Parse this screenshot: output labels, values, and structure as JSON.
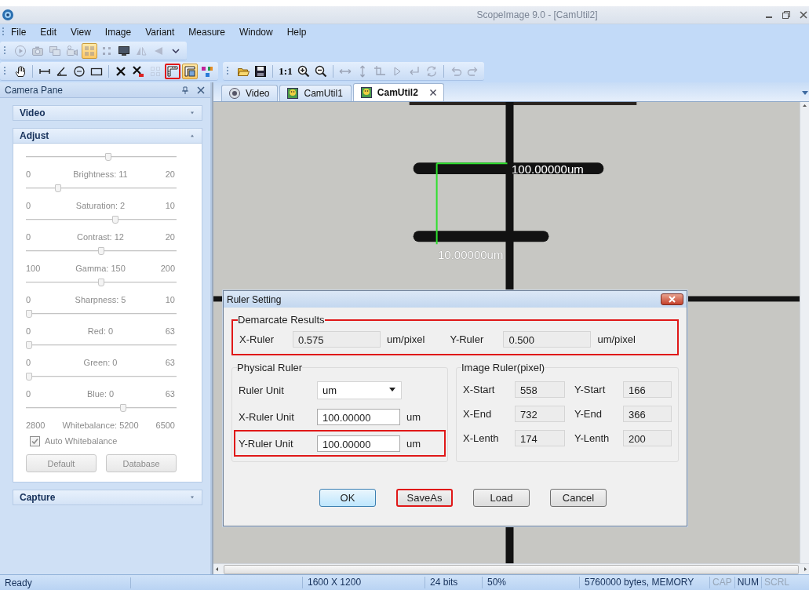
{
  "window": {
    "title": "ScopeImage 9.0 - [CamUtil2]"
  },
  "menu": [
    {
      "label": "File"
    },
    {
      "label": "Edit"
    },
    {
      "label": "View"
    },
    {
      "label": "Image"
    },
    {
      "label": "Variant"
    },
    {
      "label": "Measure"
    },
    {
      "label": "Window"
    },
    {
      "label": "Help"
    }
  ],
  "toolbar_rows": [
    [
      {
        "items": [
          {
            "kind": "play",
            "disabled": true,
            "selected": false,
            "highlighted": false
          },
          {
            "kind": "camera",
            "disabled": true,
            "selected": false,
            "highlighted": false
          },
          {
            "kind": "photos",
            "disabled": true,
            "selected": false,
            "highlighted": false
          },
          {
            "kind": "video",
            "disabled": true,
            "selected": false,
            "highlighted": false
          },
          {
            "kind": "grid",
            "disabled": true,
            "selected": true,
            "highlighted": false
          },
          {
            "kind": "dots",
            "disabled": true,
            "selected": false,
            "highlighted": false
          },
          {
            "kind": "monitor",
            "disabled": false,
            "selected": false,
            "highlighted": false
          },
          {
            "kind": "flip-a",
            "disabled": true,
            "selected": false,
            "highlighted": false
          },
          {
            "kind": "flip-b",
            "disabled": true,
            "selected": false,
            "highlighted": false
          },
          {
            "kind": "overflow",
            "disabled": false,
            "selected": false,
            "highlighted": false
          }
        ]
      }
    ],
    [
      {
        "items": [
          {
            "kind": "hand",
            "disabled": false,
            "selected": false,
            "highlighted": false
          },
          {
            "kind": "separator"
          },
          {
            "kind": "line",
            "disabled": false,
            "selected": false,
            "highlighted": false
          },
          {
            "kind": "angle",
            "disabled": false,
            "selected": false,
            "highlighted": false
          },
          {
            "kind": "circle",
            "disabled": false,
            "selected": false,
            "highlighted": false
          },
          {
            "kind": "rect",
            "disabled": false,
            "selected": false,
            "highlighted": false
          },
          {
            "kind": "separator"
          },
          {
            "kind": "cross",
            "disabled": false,
            "selected": false,
            "highlighted": false
          },
          {
            "kind": "cross-all",
            "disabled": false,
            "selected": false,
            "highlighted": false
          },
          {
            "kind": "grid-dotted",
            "disabled": true,
            "selected": false,
            "highlighted": false
          },
          {
            "kind": "ruler",
            "disabled": false,
            "selected": false,
            "highlighted": true
          },
          {
            "kind": "ruler-set",
            "disabled": false,
            "selected": true,
            "highlighted": false
          },
          {
            "kind": "color-code",
            "disabled": false,
            "selected": false,
            "highlighted": false
          }
        ]
      },
      {
        "items": [
          {
            "kind": "open",
            "disabled": false,
            "selected": false,
            "highlighted": false
          },
          {
            "kind": "save",
            "disabled": false,
            "selected": false,
            "highlighted": false
          },
          {
            "kind": "separator"
          },
          {
            "kind": "text",
            "label": "1:1",
            "disabled": false,
            "selected": false,
            "highlighted": false
          },
          {
            "kind": "zoom-in",
            "disabled": false,
            "selected": false,
            "highlighted": false
          },
          {
            "kind": "zoom-out",
            "disabled": false,
            "selected": false,
            "highlighted": false
          },
          {
            "kind": "separator"
          },
          {
            "kind": "arrows-h",
            "disabled": true,
            "selected": false,
            "highlighted": false
          },
          {
            "kind": "arrows-v",
            "disabled": true,
            "selected": false,
            "highlighted": false
          },
          {
            "kind": "corner",
            "disabled": true,
            "selected": false,
            "highlighted": false
          },
          {
            "kind": "play-outline",
            "disabled": true,
            "selected": false,
            "highlighted": false
          },
          {
            "kind": "return",
            "disabled": true,
            "selected": false,
            "highlighted": false
          },
          {
            "kind": "rotate",
            "disabled": true,
            "selected": false,
            "highlighted": false
          },
          {
            "kind": "separator"
          },
          {
            "kind": "undo",
            "disabled": true,
            "selected": false,
            "highlighted": false
          },
          {
            "kind": "redo",
            "disabled": true,
            "selected": false,
            "highlighted": false
          }
        ]
      }
    ]
  ],
  "pane": {
    "title": "Camera Pane",
    "sections": [
      {
        "title": "Video",
        "expanded": false
      },
      {
        "title": "Adjust",
        "expanded": true,
        "sliders": [
          {
            "min": "0",
            "label": "Brightness: 11",
            "max": "20",
            "level": 0.55,
            "disabled": true
          },
          {
            "min": "0",
            "label": "Saturation: 2",
            "max": "10",
            "level": 0.2,
            "disabled": true
          },
          {
            "min": "0",
            "label": "Contrast: 12",
            "max": "20",
            "level": 0.6,
            "disabled": true
          },
          {
            "min": "100",
            "label": "Gamma: 150",
            "max": "200",
            "level": 0.5,
            "disabled": true
          },
          {
            "min": "0",
            "label": "Sharpness: 5",
            "max": "10",
            "level": 0.5,
            "disabled": true
          },
          {
            "min": "0",
            "label": "Red: 0",
            "max": "63",
            "level": 0,
            "disabled": true
          },
          {
            "min": "0",
            "label": "Green: 0",
            "max": "63",
            "level": 0,
            "disabled": true
          },
          {
            "min": "0",
            "label": "Blue: 0",
            "max": "63",
            "level": 0,
            "disabled": true
          },
          {
            "min": "2800",
            "label": "Whitebalance: 5200",
            "max": "6500",
            "level": 0.65,
            "disabled": true
          }
        ],
        "checkbox": {
          "label": "Auto Whitebalance",
          "checked": true,
          "disabled": true
        },
        "buttons": [
          {
            "label": "Default",
            "disabled": true
          },
          {
            "label": "Database",
            "disabled": true
          }
        ]
      },
      {
        "title": "Capture",
        "expanded": false
      }
    ]
  },
  "tabs": [
    {
      "label": "Video",
      "kind": "video",
      "selected": false,
      "closable": false
    },
    {
      "label": "CamUtil1",
      "kind": "image",
      "selected": false,
      "closable": false
    },
    {
      "label": "CamUtil2",
      "kind": "image",
      "selected": true,
      "closable": true
    }
  ],
  "image_view": {
    "annotations": [
      {
        "label": "100.00000um"
      },
      {
        "label": "10.00000um"
      }
    ]
  },
  "dialog": {
    "title": "Ruler Setting",
    "demarcate": {
      "title": "Demarcate Results",
      "highlighted": true,
      "fields": [
        {
          "label": "X-Ruler",
          "value": "0.575",
          "unit": "um/pixel"
        },
        {
          "label": "Y-Ruler",
          "value": "0.500",
          "unit": "um/pixel"
        }
      ]
    },
    "physical": {
      "title": "Physical Ruler",
      "rows": [
        {
          "kind": "dropdown",
          "label": "Ruler Unit",
          "value": "um",
          "highlighted": false
        },
        {
          "kind": "input",
          "label": "X-Ruler Unit",
          "value": "100.00000",
          "unit": "um",
          "highlighted": false
        },
        {
          "kind": "input",
          "label": "Y-Ruler Unit",
          "value": "100.00000",
          "unit": "um",
          "highlighted": true
        }
      ]
    },
    "image_ruler": {
      "title": "Image Ruler(pixel)",
      "fields": [
        {
          "label": "X-Start",
          "value": "558"
        },
        {
          "label": "Y-Start",
          "value": "166"
        },
        {
          "label": "X-End",
          "value": "732"
        },
        {
          "label": "Y-End",
          "value": "366"
        },
        {
          "label": "X-Lenth",
          "value": "174"
        },
        {
          "label": "Y-Lenth",
          "value": "200"
        }
      ]
    },
    "buttons": [
      {
        "label": "OK",
        "default": true,
        "highlighted": false
      },
      {
        "label": "SaveAs",
        "default": false,
        "highlighted": true
      },
      {
        "label": "Load",
        "default": false,
        "highlighted": false
      },
      {
        "label": "Cancel",
        "default": false,
        "highlighted": false
      }
    ]
  },
  "status_bar": {
    "message": "Ready",
    "fields": [
      "1600 X 1200",
      "24 bits",
      "50%",
      "5760000 bytes, MEMORY"
    ],
    "indicators": [
      {
        "label": "CAP",
        "on": false
      },
      {
        "label": "NUM",
        "on": true
      },
      {
        "label": "SCRL",
        "on": false
      }
    ]
  }
}
